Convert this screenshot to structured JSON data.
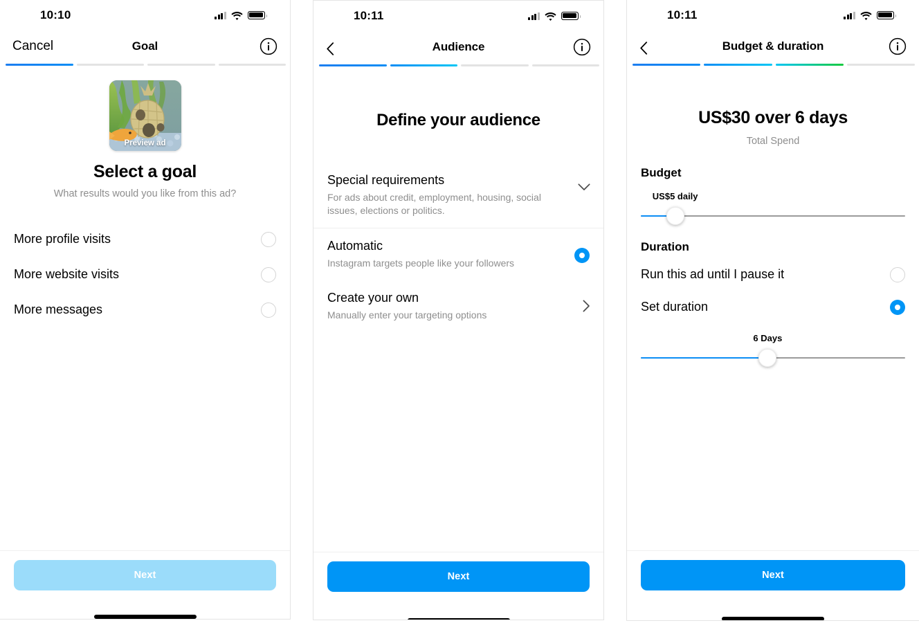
{
  "screens": [
    {
      "id": "goal",
      "status": {
        "time": "10:10",
        "signal_icon": "signal-bars-icon",
        "wifi_icon": "wifi-icon",
        "battery_icon": "battery-icon"
      },
      "nav": {
        "left_label": "Cancel",
        "title": "Goal",
        "info_icon": "info-circle-icon"
      },
      "progress": {
        "total": 4,
        "filled": 1
      },
      "preview": {
        "label": "Preview ad",
        "image_alt": "aquarium-with-pineapple-house-and-goldfish"
      },
      "title": "Select a goal",
      "subtitle": "What results would you like from this ad?",
      "options": [
        {
          "label": "More profile visits",
          "selected": false
        },
        {
          "label": "More website visits",
          "selected": false
        },
        {
          "label": "More messages",
          "selected": false
        }
      ],
      "cta": {
        "label": "Next",
        "enabled": false
      }
    },
    {
      "id": "audience",
      "status": {
        "time": "10:11",
        "signal_icon": "signal-bars-icon",
        "wifi_icon": "wifi-icon",
        "battery_icon": "battery-icon"
      },
      "nav": {
        "back_icon": "chevron-left-icon",
        "title": "Audience",
        "info_icon": "info-circle-icon"
      },
      "progress": {
        "total": 4,
        "filled": 2
      },
      "title": "Define your audience",
      "rows": [
        {
          "title": "Special requirements",
          "subtitle": "For ads about credit, employment, housing, social issues, elections or politics.",
          "control": "chevron-down-icon"
        },
        {
          "title": "Automatic",
          "subtitle": "Instagram targets people like your followers",
          "control": "radio-selected"
        },
        {
          "title": "Create your own",
          "subtitle": "Manually enter your targeting options",
          "control": "chevron-right-icon"
        }
      ],
      "cta": {
        "label": "Next",
        "enabled": true
      }
    },
    {
      "id": "budget",
      "status": {
        "time": "10:11",
        "signal_icon": "signal-bars-icon",
        "wifi_icon": "wifi-icon",
        "battery_icon": "battery-icon"
      },
      "nav": {
        "back_icon": "chevron-left-icon",
        "title": "Budget & duration",
        "info_icon": "info-circle-icon"
      },
      "progress": {
        "total": 4,
        "filled": 3
      },
      "amount": "US$30 over 6 days",
      "amount_caption": "Total Spend",
      "budget": {
        "heading": "Budget",
        "value_label": "US$5 daily",
        "slider_percent": 13
      },
      "duration": {
        "heading": "Duration",
        "options": [
          {
            "label": "Run this ad until I pause it",
            "selected": false
          },
          {
            "label": "Set duration",
            "selected": true
          }
        ],
        "value_label": "6 Days",
        "slider_percent": 48
      },
      "cta": {
        "label": "Next",
        "enabled": true
      }
    }
  ],
  "colors": {
    "accent_blue": "#0095f6",
    "accent_blue_disabled": "#9bdcfa",
    "progress_blue": "#1d7ef0",
    "progress_cyan": "#02c6f5",
    "progress_green": "#19ca3f",
    "muted_text": "#8e8e8e",
    "track_gray": "#9a9a9a"
  }
}
